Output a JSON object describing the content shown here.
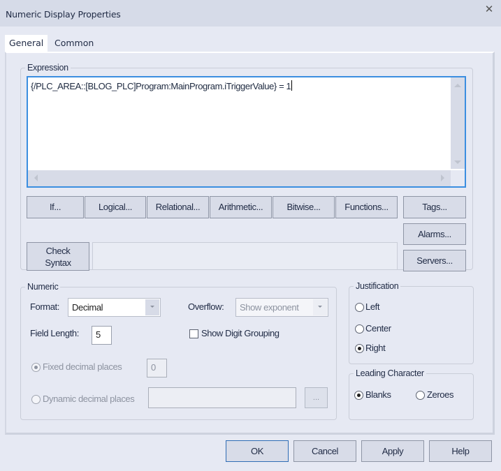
{
  "window": {
    "title": "Numeric Display Properties",
    "close_icon": "close-icon"
  },
  "tabs": [
    {
      "label": "General",
      "active": true
    },
    {
      "label": "Common",
      "active": false
    }
  ],
  "expression": {
    "group_label": "Expression",
    "value": "{/PLC_AREA::[BLOG_PLC]Program:MainProgram.iTriggerValue} = 1"
  },
  "expression_buttons": {
    "if": "If...",
    "logical": "Logical...",
    "relational": "Relational...",
    "arithmetic": "Arithmetic...",
    "bitwise": "Bitwise...",
    "functions": "Functions...",
    "tags": "Tags...",
    "alarms": "Alarms...",
    "servers": "Servers...",
    "check_syntax_line1": "Check",
    "check_syntax_line2": "Syntax"
  },
  "syntax_result": "",
  "numeric": {
    "group_label": "Numeric",
    "format_label": "Format:",
    "format_value": "Decimal",
    "overflow_label": "Overflow:",
    "overflow_value": "Show exponent",
    "field_length_label": "Field Length:",
    "field_length_value": "5",
    "show_digit_grouping_label": "Show Digit Grouping",
    "show_digit_grouping_checked": false,
    "fixed_decimal_label": "Fixed decimal places",
    "fixed_decimal_value": "0",
    "fixed_decimal_selected": true,
    "dynamic_decimal_label": "Dynamic decimal places",
    "dynamic_decimal_value": "",
    "dynamic_decimal_selected": false,
    "browse_label": "..."
  },
  "justification": {
    "group_label": "Justification",
    "options": [
      "Left",
      "Center",
      "Right"
    ],
    "selected": "Right"
  },
  "leading_character": {
    "group_label": "Leading Character",
    "options": [
      "Blanks",
      "Zeroes"
    ],
    "selected": "Blanks"
  },
  "footer": {
    "ok": "OK",
    "cancel": "Cancel",
    "apply": "Apply",
    "help": "Help"
  }
}
